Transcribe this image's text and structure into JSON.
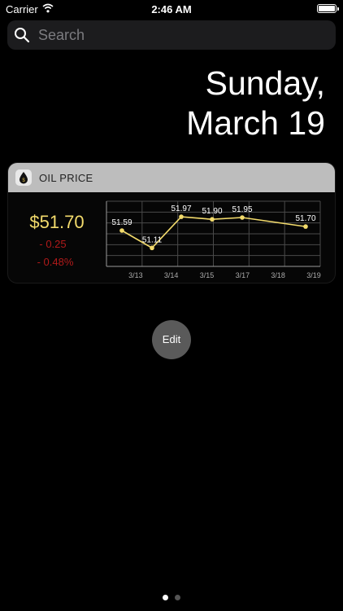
{
  "status_bar": {
    "carrier": "Carrier",
    "time": "2:46 AM"
  },
  "search": {
    "placeholder": "Search"
  },
  "date": {
    "line1": "Sunday,",
    "line2": "March 19"
  },
  "widget": {
    "title": "OIL PRICE",
    "price": "$51.70",
    "change": "- 0.25",
    "change_percent": "- 0.48%"
  },
  "chart_data": {
    "type": "line",
    "x": [
      "3/13",
      "3/14",
      "3/15",
      "3/17",
      "3/18",
      "3/19"
    ],
    "points": [
      {
        "label": "51.59",
        "value": 51.59
      },
      {
        "label": "51.11",
        "value": 51.11
      },
      {
        "label": "51.97",
        "value": 51.97
      },
      {
        "label": "51.90",
        "value": 51.9
      },
      {
        "label": "51.95",
        "value": 51.95
      },
      {
        "label": "51.70",
        "value": 51.7
      }
    ],
    "xtick_labels": [
      "3/13",
      "3/14",
      "3/15",
      "3/17",
      "3/18",
      "3/19"
    ],
    "ylim": [
      50.6,
      52.4
    ],
    "grid": true,
    "line_color": "#f3db6c"
  },
  "edit_button": {
    "label": "Edit"
  },
  "page_dots": {
    "count": 2,
    "active": 0
  }
}
